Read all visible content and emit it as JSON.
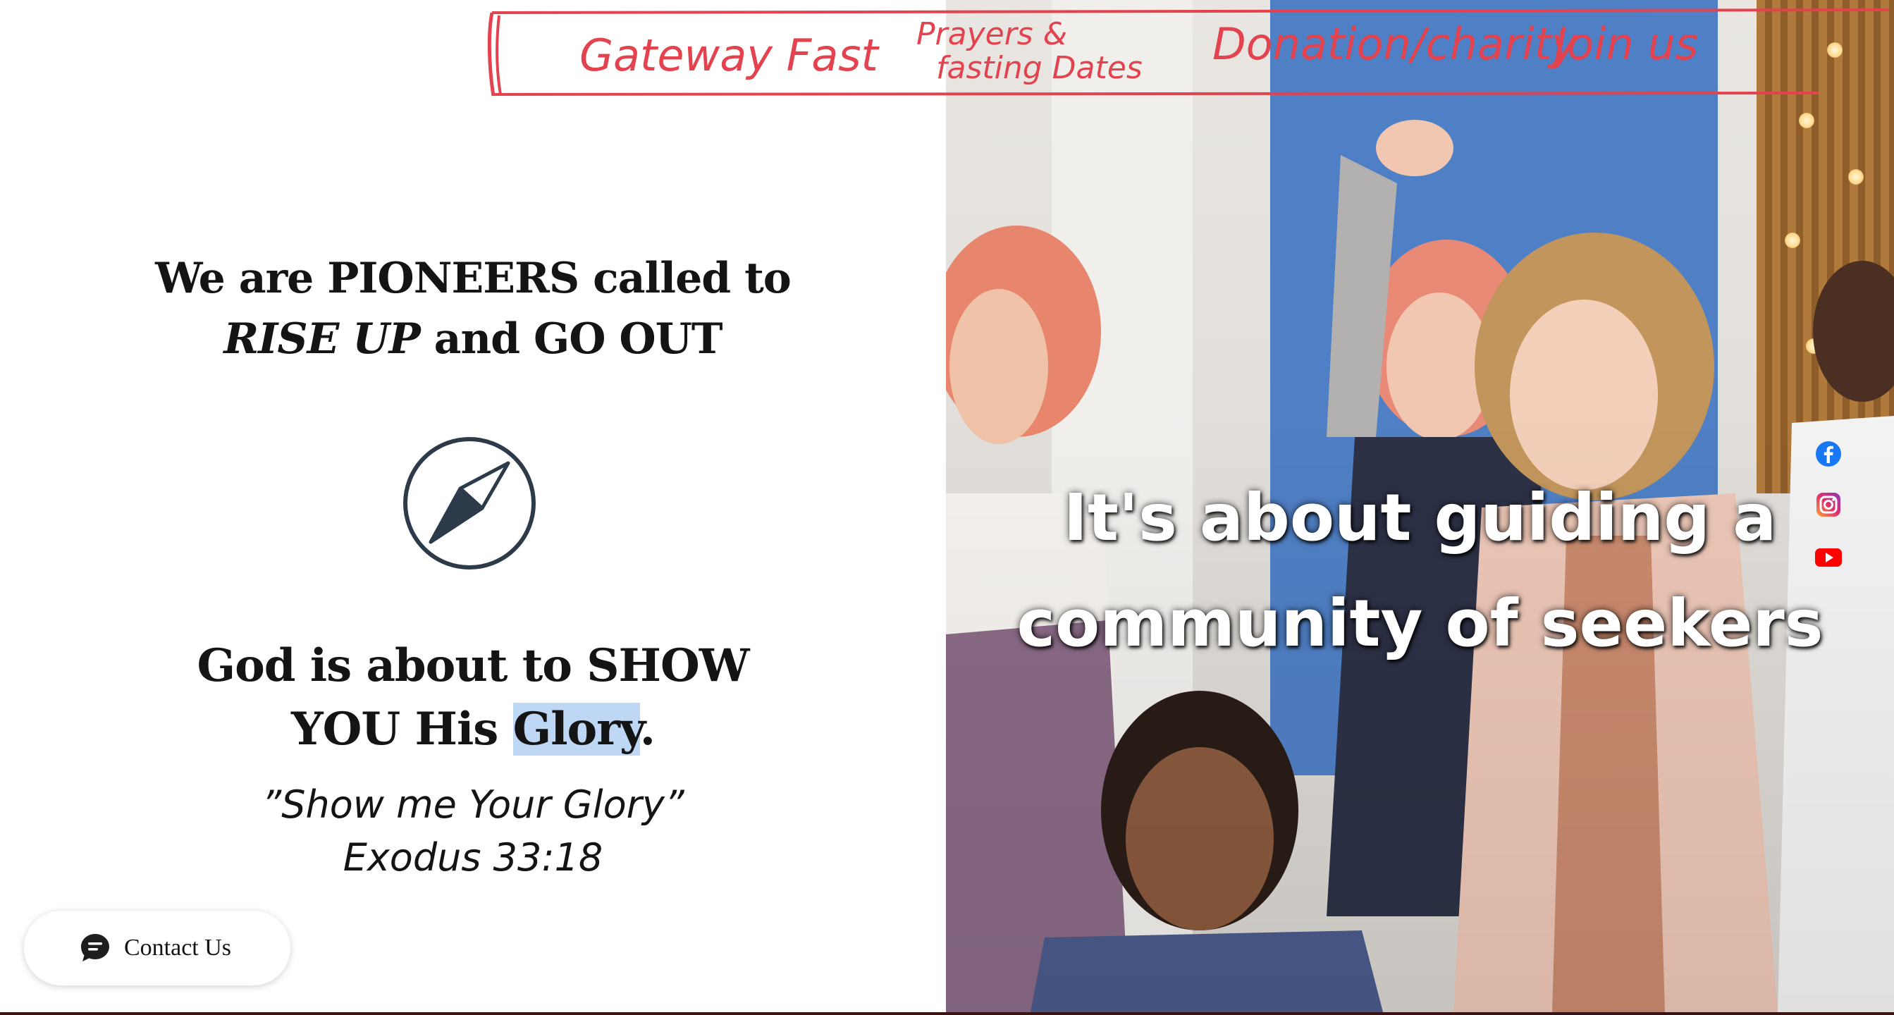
{
  "hero": {
    "headline_part1": "We are PIONEERS called to",
    "headline_em": "RISE UP",
    "headline_part2": " and GO OUT",
    "subheadline_part1": "God is about to SHOW",
    "subheadline_part2": "YOU His ",
    "subheadline_highlight": "Glory",
    "subheadline_end": ".",
    "verse_quote": "”Show me Your Glory”",
    "verse_ref": "Exodus 33:18"
  },
  "icons": {
    "compass": "compass-icon",
    "chat": "chat-bubble-icon",
    "facebook": "facebook-icon",
    "instagram": "instagram-icon",
    "youtube": "youtube-icon"
  },
  "contact": {
    "label": "Contact Us"
  },
  "video": {
    "caption_line1": "It's about guiding a",
    "caption_line2": "community of seekers"
  },
  "annotation": {
    "nav_items": [
      "Gateway Fast",
      "Prayers &",
      "fasting Dates",
      "Donation/charity",
      "Join us"
    ]
  },
  "colors": {
    "text": "#141414",
    "annotation_red": "#e2434e",
    "highlight": "#bdd7f5",
    "compass_stroke": "#2c3a4a"
  }
}
